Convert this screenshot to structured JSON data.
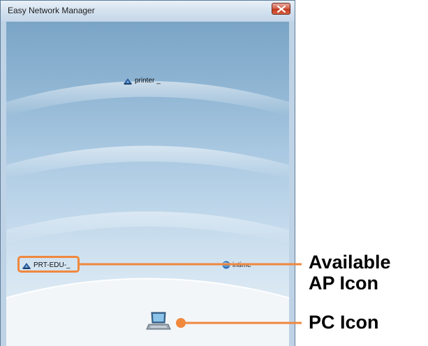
{
  "window": {
    "title": "Easy Network Manager"
  },
  "networks": [
    {
      "label": "printer _",
      "icon": "access-point-icon"
    },
    {
      "label": "PRT-EDU-_",
      "icon": "access-point-icon"
    },
    {
      "label": "intime",
      "icon": "globe-network-icon"
    }
  ],
  "pc": {
    "icon": "laptop-icon"
  },
  "callouts": {
    "available_ap_line1": "Available",
    "available_ap_line2": "AP Icon",
    "pc_icon": "PC Icon"
  },
  "colors": {
    "callout_accent": "#f0883e",
    "title_bar": "#d5e3f0",
    "close_button": "#c23a21",
    "background_top": "#7aa4c6",
    "background_bottom": "#e7f0f7"
  }
}
